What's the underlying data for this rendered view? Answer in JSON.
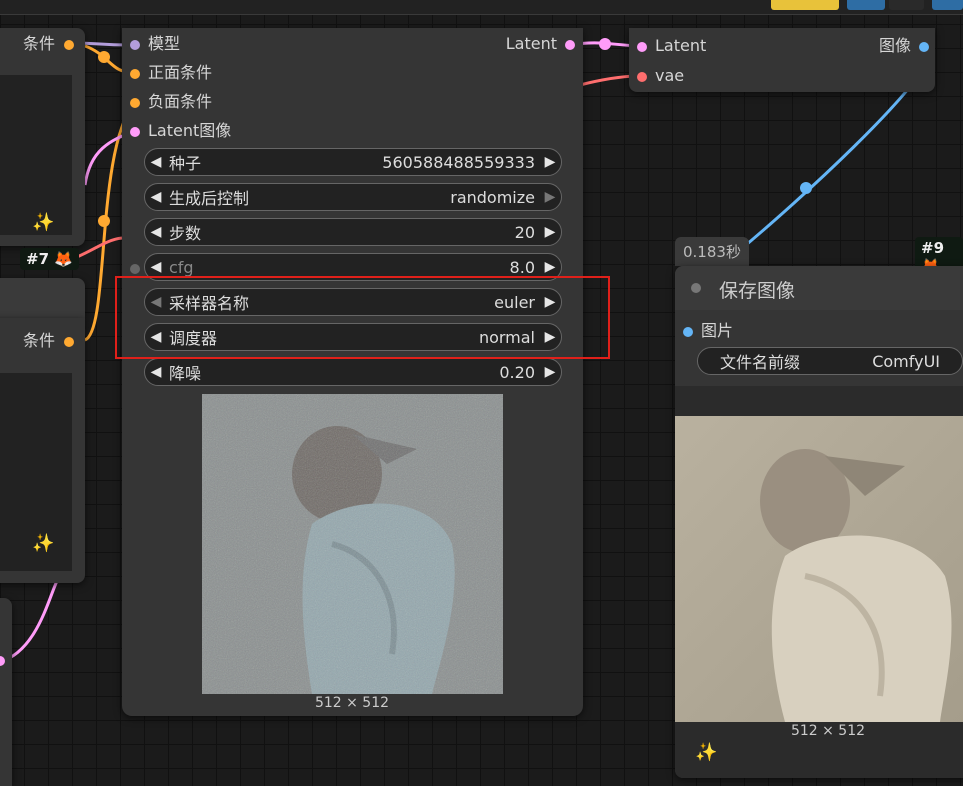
{
  "left_nodes": {
    "top_output_label": "条件",
    "bottom_output_label": "条件",
    "badge_7": "#7 🦊"
  },
  "sampler": {
    "inputs": [
      "模型",
      "正面条件",
      "负面条件",
      "Latent图像"
    ],
    "output": "Latent",
    "widgets": [
      {
        "label": "种子",
        "value": "560588488559333"
      },
      {
        "label": "生成后控制",
        "value": "randomize"
      },
      {
        "label": "步数",
        "value": "20"
      },
      {
        "label": "cfg",
        "value": "8.0"
      },
      {
        "label": "采样器名称",
        "value": "euler"
      },
      {
        "label": "调度器",
        "value": "normal"
      },
      {
        "label": "降噪",
        "value": "0.20"
      }
    ],
    "preview_caption": "512 × 512"
  },
  "decode": {
    "inputs": [
      "Latent",
      "vae"
    ],
    "output": "图像"
  },
  "save": {
    "time": "0.183秒",
    "badge": "#9 🦊",
    "title": "保存图像",
    "input": "图片",
    "widget_label": "文件名前缀",
    "widget_value": "ComfyUI",
    "preview_caption": "512 × 512"
  },
  "colors": {
    "model": "#b39ddb",
    "conditioning": "#ffa931",
    "latent": "#ff9cf9",
    "vae": "#ff6e6e",
    "image": "#64b5f6",
    "highlight": "#e0201a"
  },
  "icons": {
    "left_arrow": "◀",
    "right_arrow": "▶",
    "sparkle": "✨"
  }
}
